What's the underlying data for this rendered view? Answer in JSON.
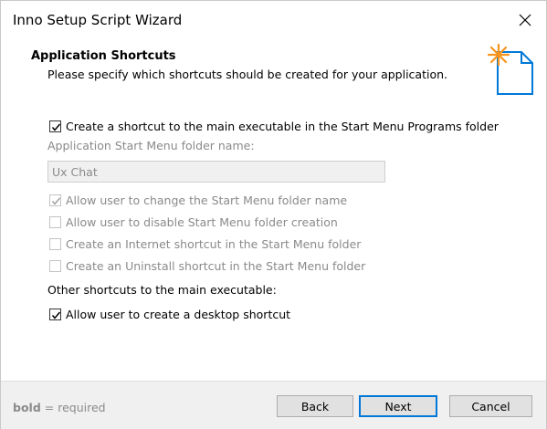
{
  "window": {
    "title": "Inno Setup Script Wizard"
  },
  "header": {
    "title": "Application Shortcuts",
    "subtitle": "Please specify which shortcuts should be created for your application.",
    "icon": "new-file-sparkle-icon"
  },
  "main": {
    "create_start_menu_shortcut": {
      "label": "Create a shortcut to the main executable in the Start Menu Programs folder",
      "checked": true
    },
    "folder_name_label": "Application Start Menu folder name:",
    "folder_name_value": "Ux Chat",
    "options": [
      {
        "label": "Allow user to change the Start Menu folder name",
        "checked": true,
        "enabled": false
      },
      {
        "label": "Allow user to disable Start Menu folder creation",
        "checked": false,
        "enabled": false
      },
      {
        "label": "Create an Internet shortcut in the Start Menu folder",
        "checked": false,
        "enabled": false
      },
      {
        "label": "Create an Uninstall shortcut in the Start Menu folder",
        "checked": false,
        "enabled": false
      }
    ],
    "other_shortcuts_label": "Other shortcuts to the main executable:",
    "desktop_shortcut": {
      "label": "Allow user to create a desktop shortcut",
      "checked": true
    }
  },
  "footer": {
    "legend_bold": "bold",
    "legend_rest": " = required",
    "back_label": "Back",
    "next_label": "Next",
    "cancel_label": "Cancel"
  },
  "colors": {
    "accent": "#0078d7",
    "icon_orange": "#f7941d",
    "disabled_text": "#8a8a8a",
    "footer_bg": "#f0f0f0"
  }
}
